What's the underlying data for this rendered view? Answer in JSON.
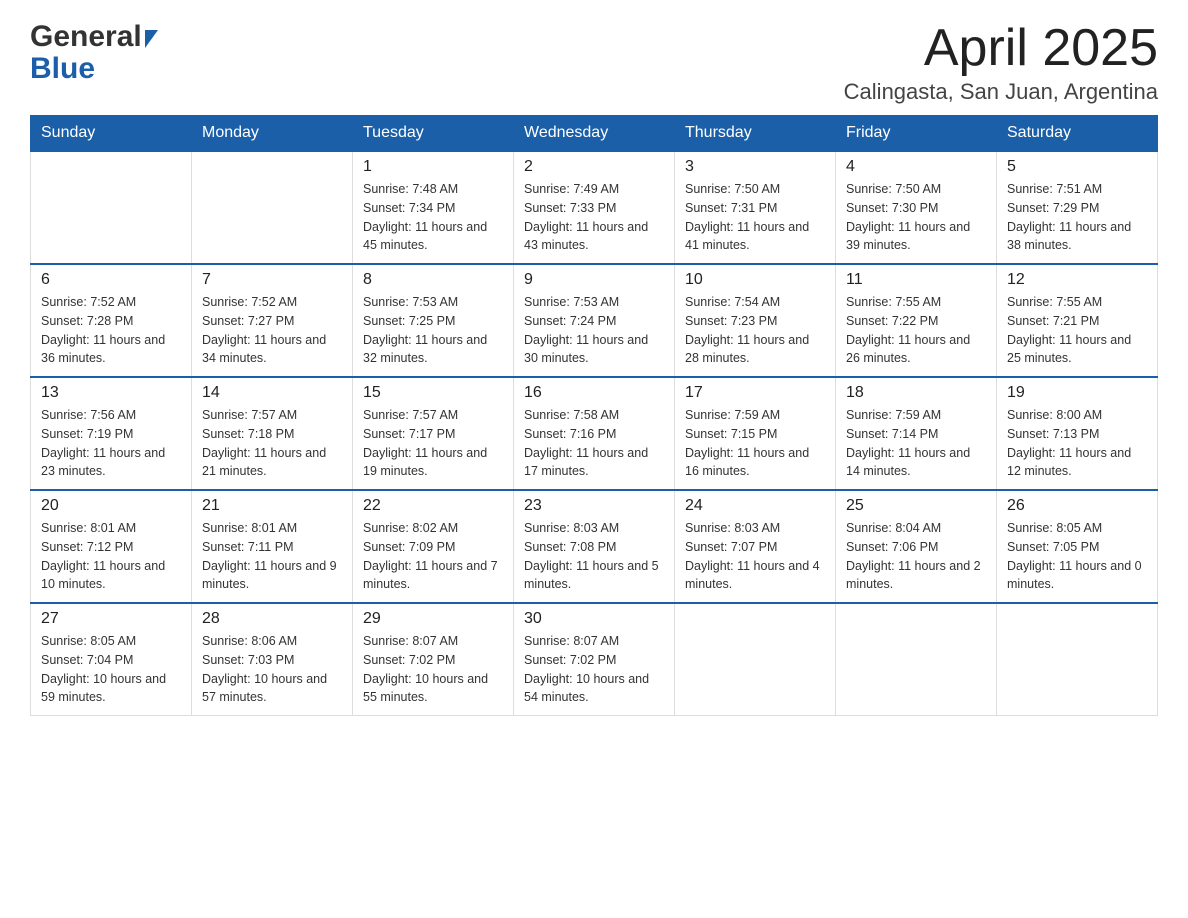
{
  "header": {
    "logo_general": "General",
    "logo_blue": "Blue",
    "title": "April 2025",
    "subtitle": "Calingasta, San Juan, Argentina"
  },
  "days_of_week": [
    "Sunday",
    "Monday",
    "Tuesday",
    "Wednesday",
    "Thursday",
    "Friday",
    "Saturday"
  ],
  "weeks": [
    [
      {
        "day": "",
        "sunrise": "",
        "sunset": "",
        "daylight": ""
      },
      {
        "day": "",
        "sunrise": "",
        "sunset": "",
        "daylight": ""
      },
      {
        "day": "1",
        "sunrise": "Sunrise: 7:48 AM",
        "sunset": "Sunset: 7:34 PM",
        "daylight": "Daylight: 11 hours and 45 minutes."
      },
      {
        "day": "2",
        "sunrise": "Sunrise: 7:49 AM",
        "sunset": "Sunset: 7:33 PM",
        "daylight": "Daylight: 11 hours and 43 minutes."
      },
      {
        "day": "3",
        "sunrise": "Sunrise: 7:50 AM",
        "sunset": "Sunset: 7:31 PM",
        "daylight": "Daylight: 11 hours and 41 minutes."
      },
      {
        "day": "4",
        "sunrise": "Sunrise: 7:50 AM",
        "sunset": "Sunset: 7:30 PM",
        "daylight": "Daylight: 11 hours and 39 minutes."
      },
      {
        "day": "5",
        "sunrise": "Sunrise: 7:51 AM",
        "sunset": "Sunset: 7:29 PM",
        "daylight": "Daylight: 11 hours and 38 minutes."
      }
    ],
    [
      {
        "day": "6",
        "sunrise": "Sunrise: 7:52 AM",
        "sunset": "Sunset: 7:28 PM",
        "daylight": "Daylight: 11 hours and 36 minutes."
      },
      {
        "day": "7",
        "sunrise": "Sunrise: 7:52 AM",
        "sunset": "Sunset: 7:27 PM",
        "daylight": "Daylight: 11 hours and 34 minutes."
      },
      {
        "day": "8",
        "sunrise": "Sunrise: 7:53 AM",
        "sunset": "Sunset: 7:25 PM",
        "daylight": "Daylight: 11 hours and 32 minutes."
      },
      {
        "day": "9",
        "sunrise": "Sunrise: 7:53 AM",
        "sunset": "Sunset: 7:24 PM",
        "daylight": "Daylight: 11 hours and 30 minutes."
      },
      {
        "day": "10",
        "sunrise": "Sunrise: 7:54 AM",
        "sunset": "Sunset: 7:23 PM",
        "daylight": "Daylight: 11 hours and 28 minutes."
      },
      {
        "day": "11",
        "sunrise": "Sunrise: 7:55 AM",
        "sunset": "Sunset: 7:22 PM",
        "daylight": "Daylight: 11 hours and 26 minutes."
      },
      {
        "day": "12",
        "sunrise": "Sunrise: 7:55 AM",
        "sunset": "Sunset: 7:21 PM",
        "daylight": "Daylight: 11 hours and 25 minutes."
      }
    ],
    [
      {
        "day": "13",
        "sunrise": "Sunrise: 7:56 AM",
        "sunset": "Sunset: 7:19 PM",
        "daylight": "Daylight: 11 hours and 23 minutes."
      },
      {
        "day": "14",
        "sunrise": "Sunrise: 7:57 AM",
        "sunset": "Sunset: 7:18 PM",
        "daylight": "Daylight: 11 hours and 21 minutes."
      },
      {
        "day": "15",
        "sunrise": "Sunrise: 7:57 AM",
        "sunset": "Sunset: 7:17 PM",
        "daylight": "Daylight: 11 hours and 19 minutes."
      },
      {
        "day": "16",
        "sunrise": "Sunrise: 7:58 AM",
        "sunset": "Sunset: 7:16 PM",
        "daylight": "Daylight: 11 hours and 17 minutes."
      },
      {
        "day": "17",
        "sunrise": "Sunrise: 7:59 AM",
        "sunset": "Sunset: 7:15 PM",
        "daylight": "Daylight: 11 hours and 16 minutes."
      },
      {
        "day": "18",
        "sunrise": "Sunrise: 7:59 AM",
        "sunset": "Sunset: 7:14 PM",
        "daylight": "Daylight: 11 hours and 14 minutes."
      },
      {
        "day": "19",
        "sunrise": "Sunrise: 8:00 AM",
        "sunset": "Sunset: 7:13 PM",
        "daylight": "Daylight: 11 hours and 12 minutes."
      }
    ],
    [
      {
        "day": "20",
        "sunrise": "Sunrise: 8:01 AM",
        "sunset": "Sunset: 7:12 PM",
        "daylight": "Daylight: 11 hours and 10 minutes."
      },
      {
        "day": "21",
        "sunrise": "Sunrise: 8:01 AM",
        "sunset": "Sunset: 7:11 PM",
        "daylight": "Daylight: 11 hours and 9 minutes."
      },
      {
        "day": "22",
        "sunrise": "Sunrise: 8:02 AM",
        "sunset": "Sunset: 7:09 PM",
        "daylight": "Daylight: 11 hours and 7 minutes."
      },
      {
        "day": "23",
        "sunrise": "Sunrise: 8:03 AM",
        "sunset": "Sunset: 7:08 PM",
        "daylight": "Daylight: 11 hours and 5 minutes."
      },
      {
        "day": "24",
        "sunrise": "Sunrise: 8:03 AM",
        "sunset": "Sunset: 7:07 PM",
        "daylight": "Daylight: 11 hours and 4 minutes."
      },
      {
        "day": "25",
        "sunrise": "Sunrise: 8:04 AM",
        "sunset": "Sunset: 7:06 PM",
        "daylight": "Daylight: 11 hours and 2 minutes."
      },
      {
        "day": "26",
        "sunrise": "Sunrise: 8:05 AM",
        "sunset": "Sunset: 7:05 PM",
        "daylight": "Daylight: 11 hours and 0 minutes."
      }
    ],
    [
      {
        "day": "27",
        "sunrise": "Sunrise: 8:05 AM",
        "sunset": "Sunset: 7:04 PM",
        "daylight": "Daylight: 10 hours and 59 minutes."
      },
      {
        "day": "28",
        "sunrise": "Sunrise: 8:06 AM",
        "sunset": "Sunset: 7:03 PM",
        "daylight": "Daylight: 10 hours and 57 minutes."
      },
      {
        "day": "29",
        "sunrise": "Sunrise: 8:07 AM",
        "sunset": "Sunset: 7:02 PM",
        "daylight": "Daylight: 10 hours and 55 minutes."
      },
      {
        "day": "30",
        "sunrise": "Sunrise: 8:07 AM",
        "sunset": "Sunset: 7:02 PM",
        "daylight": "Daylight: 10 hours and 54 minutes."
      },
      {
        "day": "",
        "sunrise": "",
        "sunset": "",
        "daylight": ""
      },
      {
        "day": "",
        "sunrise": "",
        "sunset": "",
        "daylight": ""
      },
      {
        "day": "",
        "sunrise": "",
        "sunset": "",
        "daylight": ""
      }
    ]
  ]
}
